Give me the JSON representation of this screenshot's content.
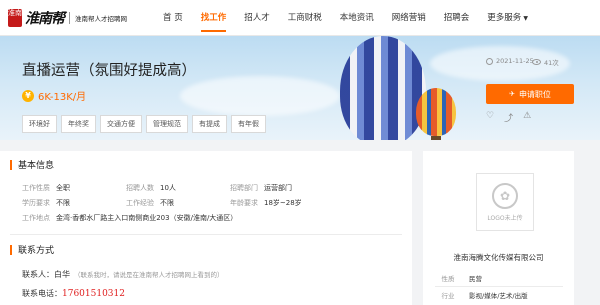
{
  "brand": {
    "seal": "淮南",
    "name": "淮南帮",
    "subtitle": "淮南帮人才招聘网"
  },
  "nav": {
    "items": [
      {
        "label": "首 页",
        "active": false
      },
      {
        "label": "找工作",
        "active": true
      },
      {
        "label": "招人才",
        "active": false
      },
      {
        "label": "工商财税",
        "active": false
      },
      {
        "label": "本地资讯",
        "active": false
      },
      {
        "label": "网络营销",
        "active": false
      },
      {
        "label": "招聘会",
        "active": false
      },
      {
        "label": "更多服务",
        "active": false
      }
    ]
  },
  "job": {
    "title": "直播运营（氛围好提成高）",
    "salary": "6K-13K/月",
    "tags": [
      "环境好",
      "年终奖",
      "交通方便",
      "管理规范",
      "有提成",
      "有年假"
    ],
    "date": "2021-11-25",
    "views": "41次",
    "apply_label": "申请职位"
  },
  "basic_info": {
    "title": "基本信息",
    "rows": [
      [
        {
          "label": "工作性质",
          "value": "全职"
        },
        {
          "label": "招聘人数",
          "value": "10人"
        },
        {
          "label": "招聘部门",
          "value": "运营部门"
        }
      ],
      [
        {
          "label": "学历要求",
          "value": "不限"
        },
        {
          "label": "工作经验",
          "value": "不限"
        },
        {
          "label": "年龄要求",
          "value": "18岁~28岁"
        }
      ]
    ],
    "address_label": "工作地点",
    "address": "金湾·香都水厂路主入口南侧商业203（安徽/淮南/大通区）"
  },
  "contact": {
    "title": "联系方式",
    "person_label": "联系人：",
    "person": "白华",
    "person_note": "（联系我时，请说是在淮南帮人才招聘网上看到的）",
    "phone_label": "联系电话：",
    "phone": "17601510312"
  },
  "company": {
    "logo_placeholder": "LOGO未上传",
    "name": "淮南海腾文化传媒有限公司",
    "rows": [
      {
        "label": "性质",
        "value": "民营"
      },
      {
        "label": "行业",
        "value": "影视/媒体/艺术/出版"
      }
    ]
  },
  "colors": {
    "accent": "#ff6a00",
    "phone": "#e02020"
  }
}
